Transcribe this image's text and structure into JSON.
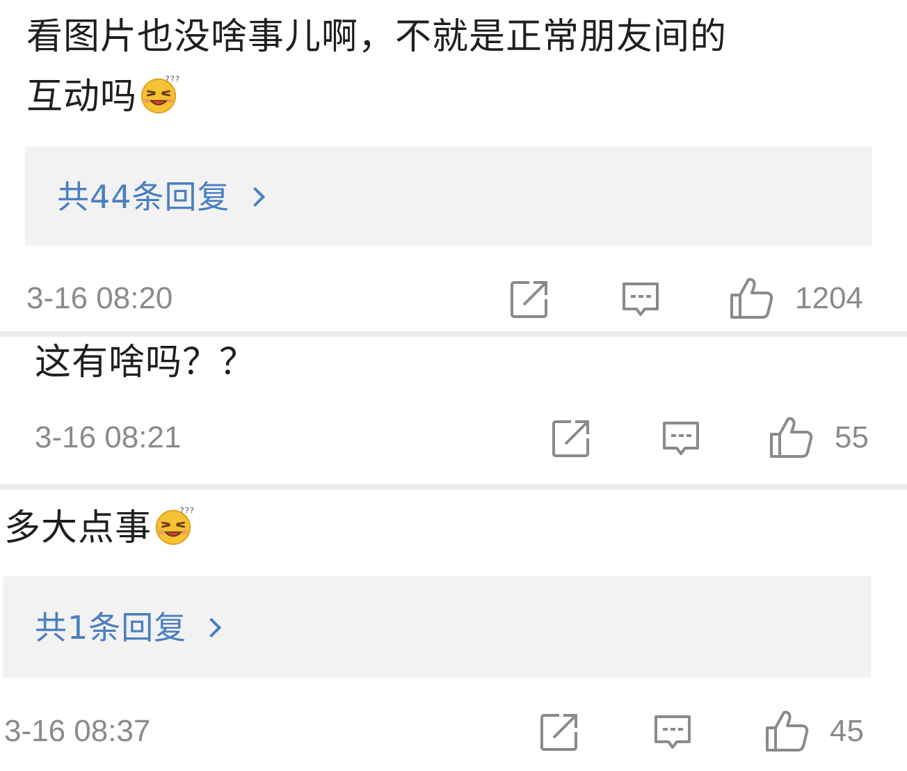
{
  "comments": [
    {
      "text_line1": "看图片也没啥事儿啊，不就是正常朋友间的",
      "text_line2": "互动吗",
      "emoji": "squinting-face-emoji",
      "reply_label": "共44条回复",
      "timestamp": "3-16 08:20",
      "likes": "1204"
    },
    {
      "text_line1": "这有啥吗？？",
      "timestamp": "3-16 08:21",
      "likes": "55"
    },
    {
      "text_line1": "多大点事",
      "emoji": "squinting-face-emoji",
      "reply_label": "共1条回复",
      "timestamp": "3-16 08:37",
      "likes": "45"
    }
  ],
  "icons": {
    "share": "share-icon",
    "comment": "comment-icon",
    "like": "thumbs-up-icon"
  },
  "colors": {
    "link": "#4a7fc1",
    "meta": "#8a8a8a",
    "reply_bg": "#f2f2f2"
  }
}
